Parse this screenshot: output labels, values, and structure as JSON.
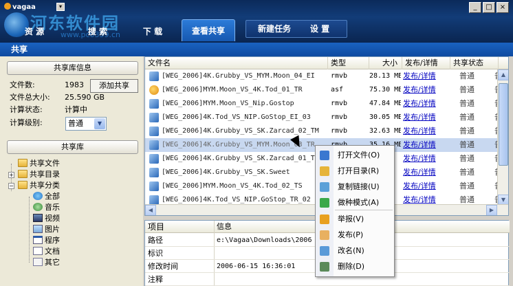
{
  "app": {
    "logo_text": "vagaa",
    "watermark": {
      "title": "河东软件园",
      "url": "www.pc0359.cn"
    },
    "window_controls": [
      "_",
      "□",
      "×"
    ]
  },
  "nav": {
    "tabs": [
      {
        "label": "资 源"
      },
      {
        "label": "搜 索"
      },
      {
        "label": "下 载"
      },
      {
        "label": "查看共享",
        "active": true
      }
    ],
    "group": [
      {
        "label": "新建任务"
      },
      {
        "label": "设 置"
      }
    ]
  },
  "page_title": "共享",
  "library_info": {
    "header": "共享库信息",
    "rows": [
      {
        "label": "文件数:",
        "value": "1983"
      },
      {
        "label": "文件总大小:",
        "value": "25.590 GB"
      },
      {
        "label": "计算状态:",
        "value": "计算中"
      },
      {
        "label": "计算级别:",
        "value": "普通"
      }
    ],
    "add_button": "添加共享"
  },
  "library": {
    "header": "共享库",
    "tree": [
      {
        "label": "共享文件",
        "icon": "folder-icon"
      },
      {
        "label": "共享目录",
        "icon": "folder-icon"
      },
      {
        "label": "共享分类",
        "icon": "folder-icon"
      },
      {
        "label": "全部",
        "icon": "globe-icon"
      },
      {
        "label": "音乐",
        "icon": "music-icon"
      },
      {
        "label": "视频",
        "icon": "video-icon"
      },
      {
        "label": "图片",
        "icon": "image-icon"
      },
      {
        "label": "程序",
        "icon": "program-icon"
      },
      {
        "label": "文档",
        "icon": "document-icon"
      },
      {
        "label": "其它",
        "icon": "other-icon"
      }
    ]
  },
  "file_list": {
    "columns": [
      "文件名",
      "类型",
      "大小",
      "发布/详情",
      "共享状态"
    ],
    "rows": [
      {
        "name": "[WEG_2006]4K.Grubby_VS_MYM.Moon_04_EI",
        "type": "rmvb",
        "size": "28.13 MB",
        "publish": "发布/详情",
        "status": "普通",
        "extra": "普",
        "icon": "rmvb"
      },
      {
        "name": "[WEG_2006]MYM.Moon_VS_4K.Tod_01_TR",
        "type": "asf",
        "size": "75.30 MB",
        "publish": "发布/详情",
        "status": "普通",
        "extra": "普",
        "icon": "asf"
      },
      {
        "name": "[WEG_2006]MYM.Moon_VS_Nip.Gostop",
        "type": "rmvb",
        "size": "47.84 MB",
        "publish": "发布/详情",
        "status": "普通",
        "extra": "普",
        "icon": "rmvb"
      },
      {
        "name": "[WEG_2006]4K.Tod_VS_NIP.GoStop_EI_03",
        "type": "rmvb",
        "size": "30.05 MB",
        "publish": "发布/详情",
        "status": "普通",
        "extra": "普",
        "icon": "rmvb"
      },
      {
        "name": "[WEG_2006]4K.Grubby_VS_SK.Zarcad_02_TM",
        "type": "rmvb",
        "size": "32.63 MB",
        "publish": "发布/详情",
        "status": "普通",
        "extra": "普",
        "icon": "rmvb"
      },
      {
        "name": "[WEG_2006]4K.Grubby_VS_MYM.Moon_03_TR",
        "type": "rmvb",
        "size": "35.16 MB",
        "publish": "发布/详情",
        "status": "普通",
        "extra": "普",
        "icon": "rmvb",
        "selected": true
      },
      {
        "name": "[WEG_2006]4K.Grubby_VS_SK.Zarcad_01_TS",
        "type": "rmvb",
        "size": "",
        "publish": "发布/详情",
        "status": "普通",
        "extra": "普",
        "icon": "rmvb"
      },
      {
        "name": "[WEG_2006]4K.Grubby_VS_SK.Sweet",
        "type": "rmvb",
        "size": "",
        "publish": "发布/详情",
        "status": "普通",
        "extra": "普",
        "icon": "rmvb"
      },
      {
        "name": "[WEG_2006]MYM.Moon_VS_4K.Tod_02_TS",
        "type": "rmvb",
        "size": "",
        "publish": "发布/详情",
        "status": "普通",
        "extra": "普",
        "icon": "rmvb"
      },
      {
        "name": "[WEG_2006]4K.Tod_VS_NIP.GoStop_TR_02",
        "type": "rmvb",
        "size": "",
        "publish": "发布/详情",
        "status": "普通",
        "extra": "普",
        "icon": "rmvb"
      }
    ]
  },
  "details": {
    "columns": [
      "项目",
      "信息"
    ],
    "rows": [
      {
        "key": "路径",
        "value": "e:\\Vagaa\\Downloads\\2006"
      },
      {
        "key": "标识",
        "value": ""
      },
      {
        "key": "修改时间",
        "value": "2006-06-15 16:36:01"
      },
      {
        "key": "注释",
        "value": ""
      }
    ]
  },
  "context_menu": {
    "items": [
      {
        "label": "打开文件(O)",
        "icon": "play-icon",
        "color": "#3a78d0"
      },
      {
        "label": "打开目录(R)",
        "icon": "folder-open-icon",
        "color": "#e6b43a"
      },
      {
        "label": "复制链接(U)",
        "icon": "copy-link-icon",
        "color": "#5aa0d8"
      },
      {
        "label": "做种模式(A)",
        "icon": "seed-icon",
        "color": "#3aa84a"
      },
      {
        "label": "举报(V)",
        "icon": "report-icon",
        "color": "#e8a020"
      },
      {
        "label": "发布(P)",
        "icon": "publish-icon",
        "color": "#e8b060"
      },
      {
        "label": "改名(N)",
        "icon": "rename-icon",
        "color": "#5a9ad8"
      },
      {
        "label": "删除(D)",
        "icon": "delete-icon",
        "color": "#5a8a5a"
      }
    ]
  }
}
